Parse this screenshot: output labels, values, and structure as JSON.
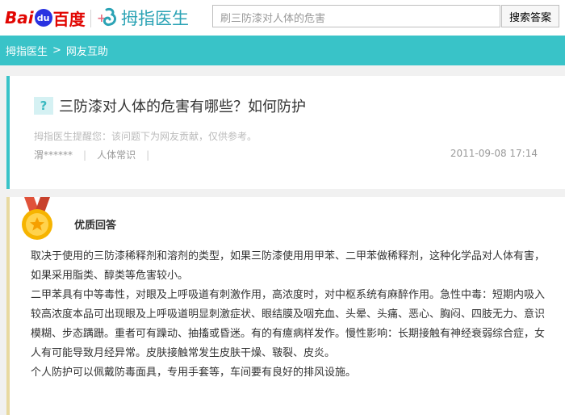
{
  "header": {
    "baidu_logo": {
      "latin": "Bai",
      "paw": "du",
      "cn": "百度"
    },
    "site_name": "拇指医生",
    "search": {
      "value": "刷三防漆对人体的危害"
    },
    "search_button": "搜索答案"
  },
  "breadcrumb": {
    "home": "拇指医生",
    "separator": ">",
    "current": "网友互助"
  },
  "question": {
    "icon": "?",
    "title": "三防漆对人体的危害有哪些？如何防护",
    "notice": "拇指医生提醒您：该问题下为网友贡献，仅供参考。",
    "author": "渭******",
    "category": "人体常识",
    "date": "2011-09-08 17:14"
  },
  "answer": {
    "label": "优质回答",
    "medal_icon": "gold-medal-icon",
    "lines": [
      "取决于使用的三防漆稀释剂和溶剂的类型，如果三防漆使用用甲苯、二甲苯做稀释剂，这种化学品对人体有害，如果采用脂类、醇类等危害较小。",
      "二甲苯具有中等毒性，对眼及上呼吸道有刺激作用，高浓度时，对中枢系统有麻醉作用。急性中毒：短期内吸入较高浓度本品可出现眼及上呼吸道明显刺激症状、眼结膜及咽充血、头晕、头痛、恶心、胸闷、四肢无力、意识模糊、步态蹒跚。重者可有躁动、抽搐或昏迷。有的有癔病样发作。慢性影响：长期接触有神经衰弱综合症，女人有可能导致月经异常。皮肤接触常发生皮肤干燥、皲裂、皮炎。",
      "个人防护可以佩戴防毒面具，专用手套等，车间要有良好的排风设施。"
    ]
  },
  "colors": {
    "accent": "#39c3c8",
    "baidu_red": "#e10602",
    "baidu_blue": "#2932e1",
    "medal_gold": "#f6b400",
    "medal_ribbon": "#e0523a"
  }
}
